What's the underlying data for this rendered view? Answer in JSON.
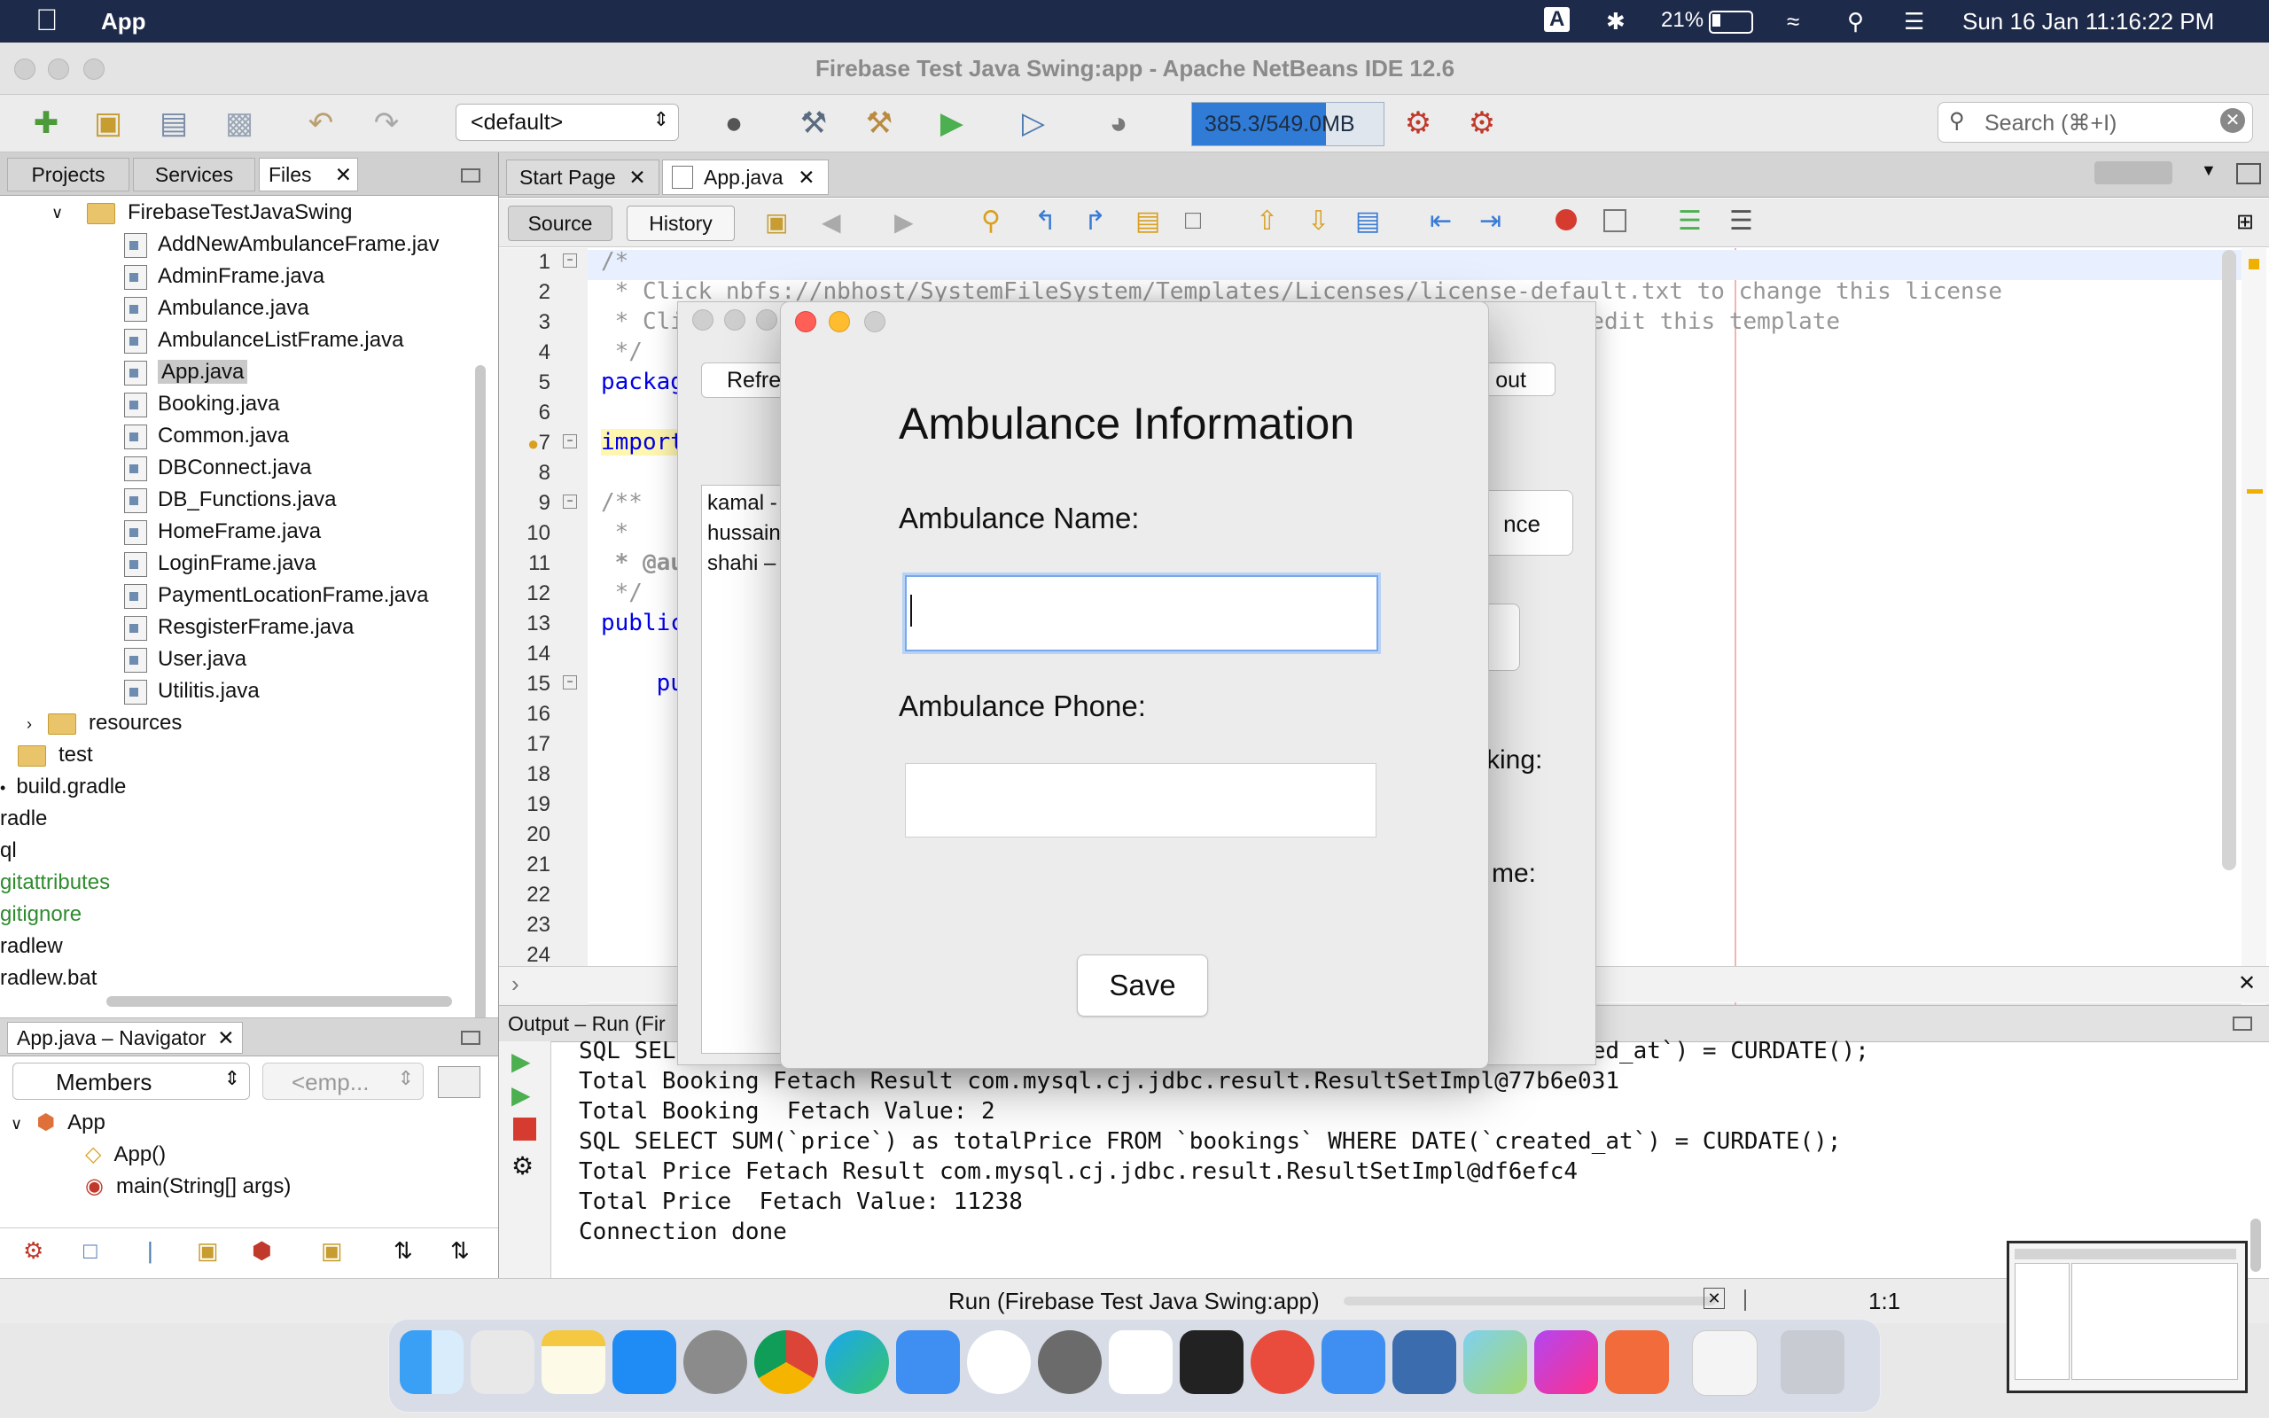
{
  "menubar": {
    "app_name": "App",
    "input_indicator": "A",
    "battery": "21%",
    "datetime": "Sun 16 Jan  11:16:22 PM"
  },
  "window": {
    "title": "Firebase Test Java Swing:app - Apache NetBeans IDE 12.6"
  },
  "toolbar": {
    "config_select": "<default>",
    "memory": "385.3/549.0MB",
    "search_placeholder": "Search (⌘+I)"
  },
  "left_panel": {
    "tabs": [
      "Projects",
      "Services",
      "Files"
    ],
    "root_folder": "FirebaseTestJavaSwing",
    "files": [
      "AddNewAmbulanceFrame.jav",
      "AdminFrame.java",
      "Ambulance.java",
      "AmbulanceListFrame.java",
      "App.java",
      "Booking.java",
      "Common.java",
      "DBConnect.java",
      "DB_Functions.java",
      "HomeFrame.java",
      "LoginFrame.java",
      "PaymentLocationFrame.java",
      "ResgisterFrame.java",
      "User.java",
      "Utilitis.java"
    ],
    "selected_file": "App.java",
    "resources_folder": "resources",
    "test_folder": "test",
    "root_files": [
      "build.gradle",
      "radle",
      "ql",
      "gitattributes",
      "gitignore",
      "radlew",
      "radlew.bat"
    ]
  },
  "navigator": {
    "title": "App.java – Navigator",
    "filter_select": "Members",
    "filter_select2": "<emp...",
    "class_name": "App",
    "constructor": "App()",
    "method": "main(String[] args)"
  },
  "editor": {
    "tabs": [
      "Start Page",
      "App.java"
    ],
    "active_tab": "App.java",
    "source_button": "Source",
    "history_button": "History",
    "line_numbers": [
      "1",
      "2",
      "3",
      "4",
      "5",
      "6",
      "7",
      "8",
      "9",
      "10",
      "11",
      "12",
      "13",
      "14",
      "15",
      "16",
      "17",
      "18",
      "19",
      "20",
      "21",
      "22",
      "23",
      "24"
    ],
    "code_lines": {
      "l1": "/*",
      "l2a": " * Click nbfs://nbhost/SystemFileSystem/Templates/Licenses/license-default.txt",
      "l2b": " to change this license",
      "l3a": " * Cli",
      "l3b": "o edit this template",
      "l4": " */",
      "l5": "packag",
      "l7": "import",
      "l9": "/**",
      "l10": " *",
      "l11": " * @au",
      "l12": " */",
      "l13": "public",
      "l15": "    pu"
    }
  },
  "bg_window": {
    "refresh_button": "Refre",
    "logout_button": "out",
    "list_items": [
      "kamal -",
      "hussain",
      "shahi –"
    ],
    "ance_button": "nce",
    "booking_label": "king:",
    "name_label": "me:"
  },
  "modal": {
    "heading": "Ambulance Information",
    "name_label": "Ambulance Name:",
    "name_value": "",
    "phone_label": "Ambulance Phone:",
    "phone_value": "",
    "save_button": "Save"
  },
  "output": {
    "title": "Output – Run (Fir",
    "lines": [
      "SQL SEL                                                                ated_at`) = CURDATE();",
      "Total Booking Fetach Result com.mysql.cj.jdbc.result.ResultSetImpl@77b6e031",
      "Total Booking  Fetach Value: 2",
      "SQL SELECT SUM(`price`) as totalPrice FROM `bookings` WHERE DATE(`created_at`) = CURDATE();",
      "Total Price Fetach Result com.mysql.cj.jdbc.result.ResultSetImpl@df6efc4",
      "Total Price  Fetach Value: 11238",
      "Connection done"
    ]
  },
  "statusbar": {
    "run_label": "Run (Firebase Test Java Swing:app)",
    "position": "1:1"
  },
  "colors": {
    "menubar_bg": "#1e2a4a",
    "memory_fill": "#2f7bd6",
    "traffic_red": "#ff5f57",
    "traffic_yellow": "#febc2e",
    "keyword_blue": "#0000e6",
    "comment_gray": "#969696"
  }
}
